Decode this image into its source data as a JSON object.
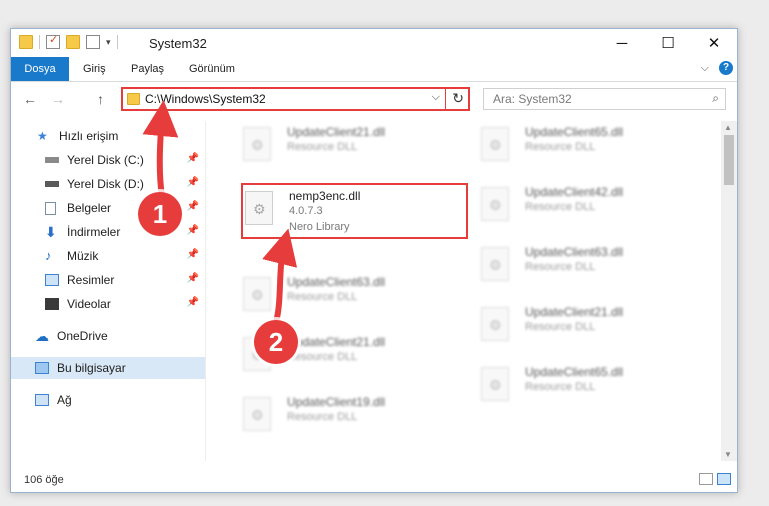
{
  "window": {
    "title": "System32",
    "controls": {
      "minimize": "─",
      "maximize": "☐",
      "close": "✕"
    }
  },
  "ribbon": {
    "tabs": [
      "Dosya",
      "Giriş",
      "Paylaş",
      "Görünüm"
    ],
    "collapse_glyph": "⌵",
    "help_glyph": "?"
  },
  "nav": {
    "back": "←",
    "forward": "→",
    "up": "↑",
    "address": "C:\\Windows\\System32",
    "address_dropdown": "⌵",
    "refresh": "↻",
    "search_placeholder": "Ara: System32",
    "search_icon": "⌕"
  },
  "sidebar": {
    "items": [
      {
        "label": "Hızlı erişim",
        "icon": "star-icon"
      },
      {
        "label": "Yerel Disk (C:)",
        "icon": "drive-icon",
        "pinned": true
      },
      {
        "label": "Yerel Disk (D:)",
        "icon": "drive-icon",
        "pinned": true
      },
      {
        "label": "Belgeler",
        "icon": "document-icon",
        "pinned": true
      },
      {
        "label": "İndirmeler",
        "icon": "download-icon",
        "pinned": true
      },
      {
        "label": "Müzik",
        "icon": "music-icon",
        "pinned": true
      },
      {
        "label": "Resimler",
        "icon": "pictures-icon",
        "pinned": true
      },
      {
        "label": "Videolar",
        "icon": "video-icon",
        "pinned": true
      },
      {
        "label": "OneDrive",
        "icon": "cloud-icon"
      },
      {
        "label": "Bu bilgisayar",
        "icon": "computer-icon",
        "selected": true
      },
      {
        "label": "Ağ",
        "icon": "network-icon"
      }
    ],
    "pin_glyph": "📌"
  },
  "files": {
    "highlighted": {
      "name": "nemp3enc.dll",
      "version": "4.0.7.3",
      "description": "Nero Library"
    },
    "left_column": [
      {
        "name": "UpdateClient21.dll",
        "description": "Resource DLL"
      },
      {
        "name": "UpdateClient63.dll",
        "description": "Resource DLL"
      },
      {
        "name": "UpdateClient21.dll",
        "description": "Resource DLL"
      },
      {
        "name": "UpdateClient19.dll",
        "description": "Resource DLL"
      }
    ],
    "right_column": [
      {
        "name": "UpdateClient65.dll",
        "description": "Resource DLL"
      },
      {
        "name": "UpdateClient42.dll",
        "description": "Resource DLL"
      },
      {
        "name": "UpdateClient63.dll",
        "description": "Resource DLL"
      },
      {
        "name": "UpdateClient21.dll",
        "description": "Resource DLL"
      },
      {
        "name": "UpdateClient65.dll",
        "description": "Resource DLL"
      }
    ]
  },
  "status": {
    "item_count": "106 öğe"
  },
  "annotations": {
    "badge1": "1",
    "badge2": "2"
  },
  "colors": {
    "accent": "#1979ca",
    "annotation_red": "#e63c3c",
    "selected_bg": "#d9e8f7"
  }
}
